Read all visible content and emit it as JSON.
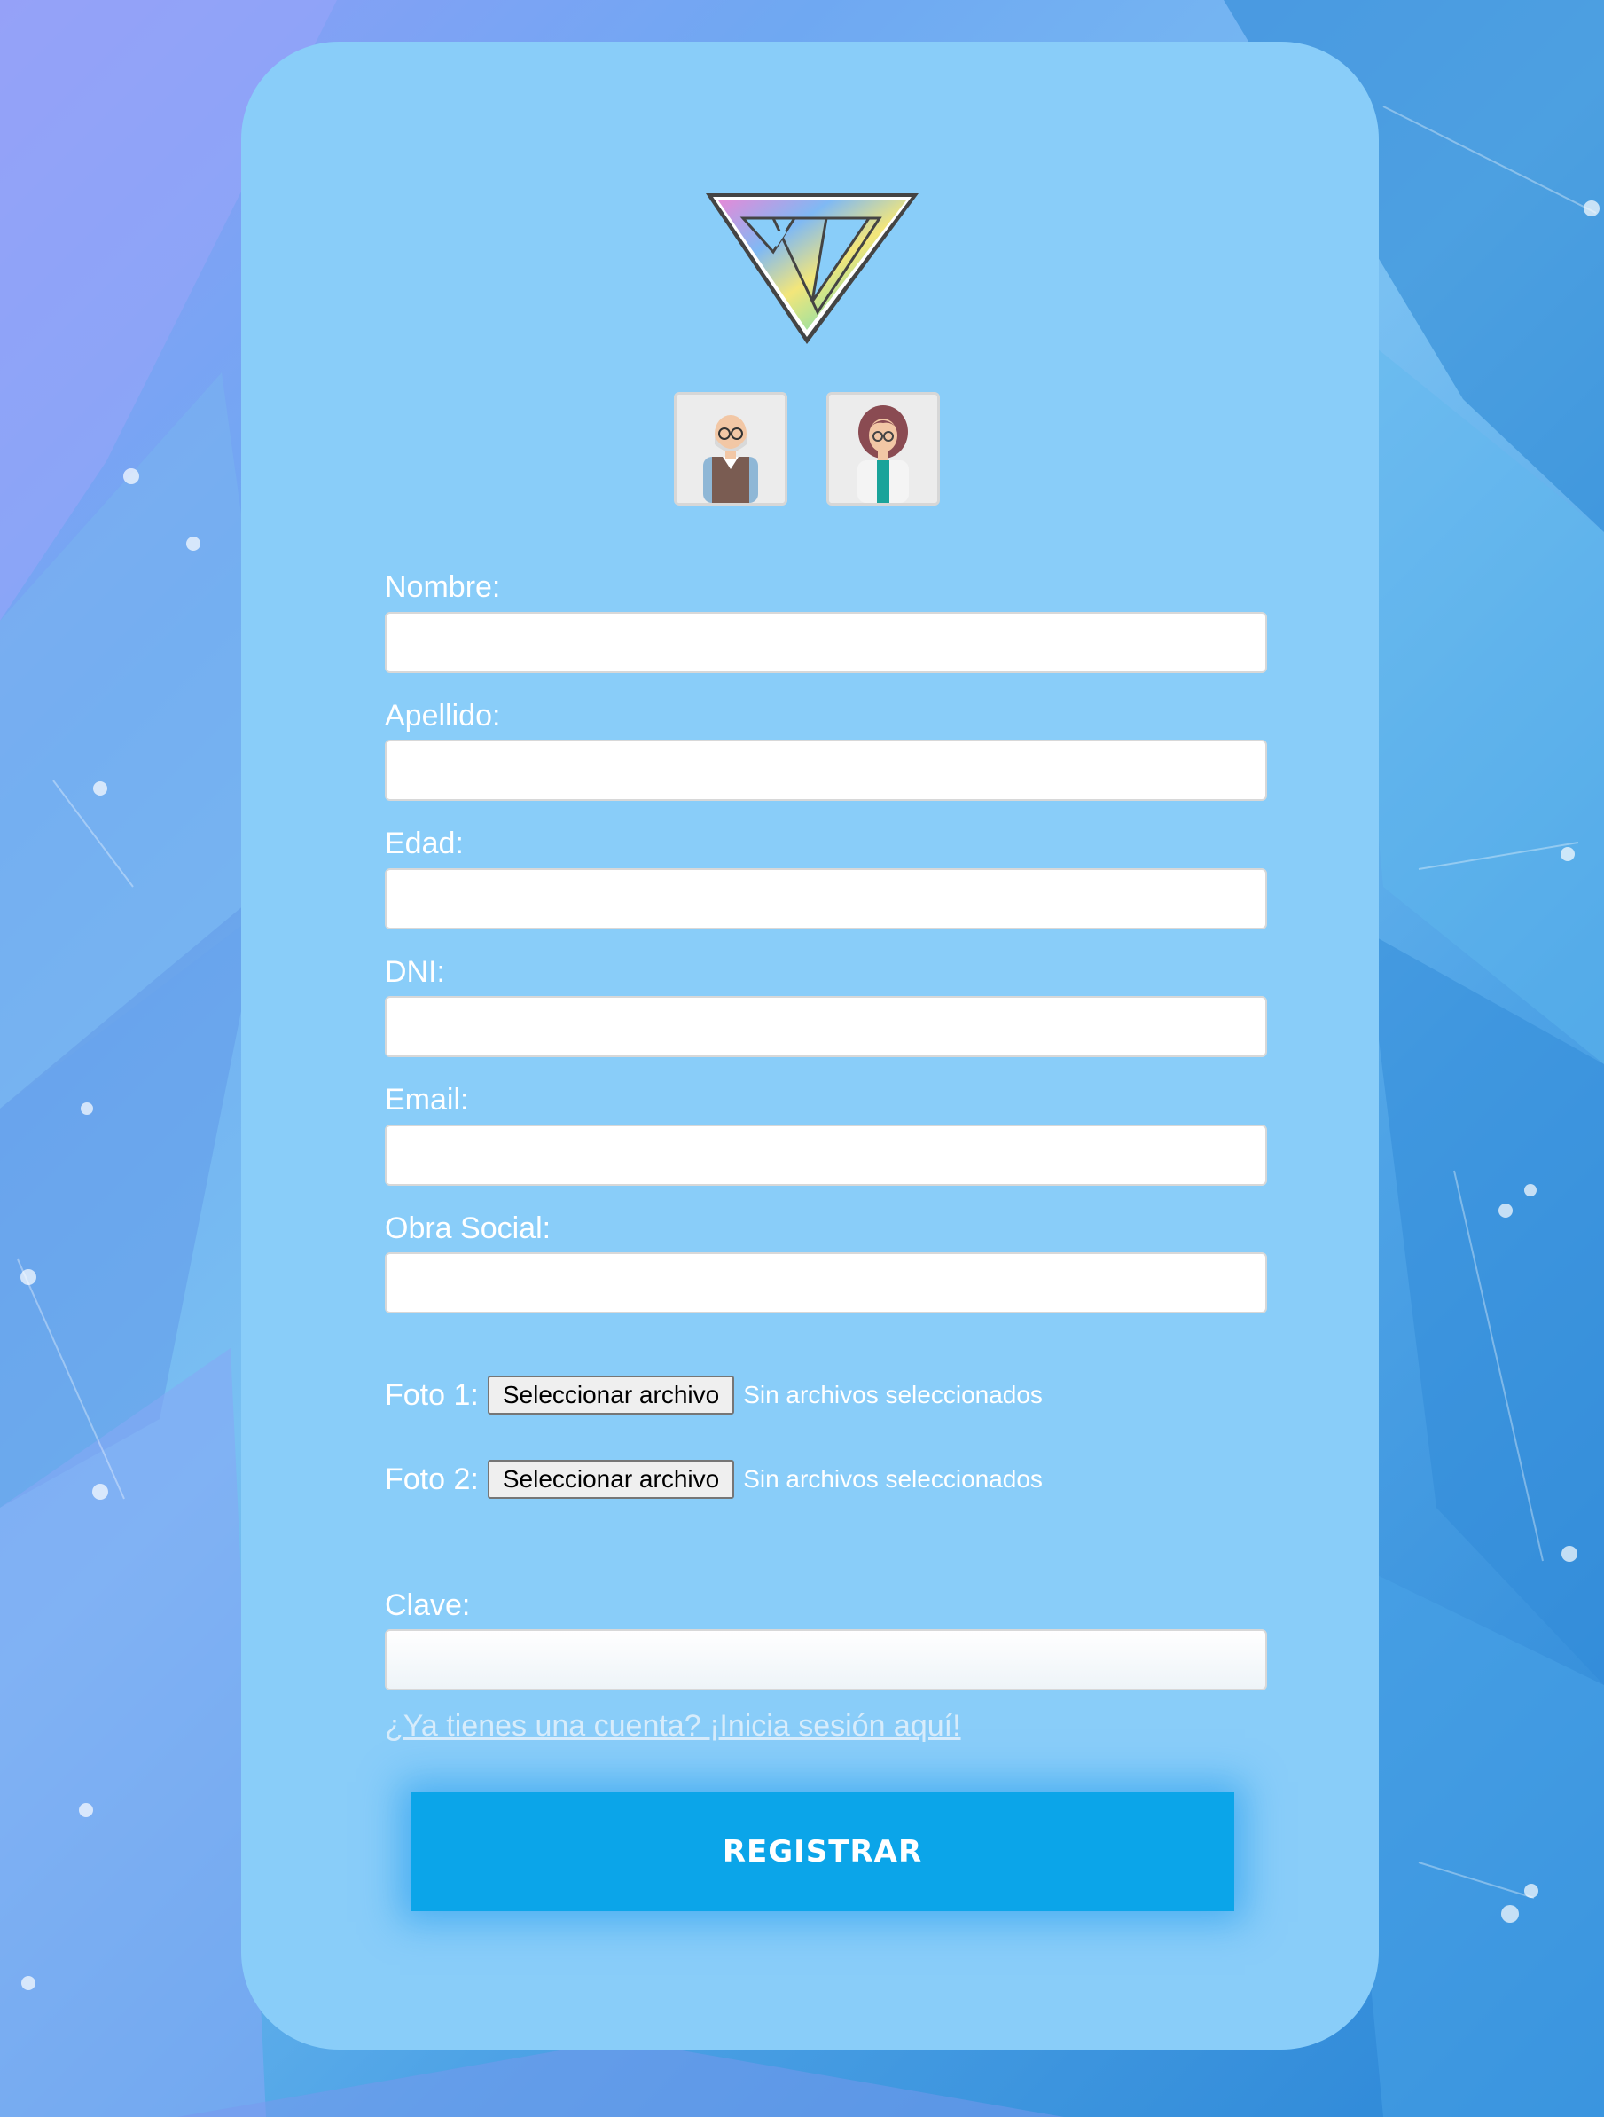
{
  "theme": {
    "card_bg": "#89cdf9",
    "button_bg": "#0ba5e9",
    "label_color": "#ffffff",
    "link_color": "#d7ecfb"
  },
  "logo": {
    "icon": "triangle-w-logo"
  },
  "avatars": [
    {
      "icon": "patient-elderly-man-avatar"
    },
    {
      "icon": "doctor-woman-avatar"
    }
  ],
  "form": {
    "nombre": {
      "label": "Nombre:",
      "value": ""
    },
    "apellido": {
      "label": "Apellido:",
      "value": ""
    },
    "edad": {
      "label": "Edad:",
      "value": ""
    },
    "dni": {
      "label": "DNI:",
      "value": ""
    },
    "email": {
      "label": "Email:",
      "value": ""
    },
    "obra_social": {
      "label": "Obra Social:",
      "value": ""
    },
    "foto1": {
      "label": "Foto 1:",
      "button": "Seleccionar archivo",
      "status": "Sin archivos seleccionados"
    },
    "foto2": {
      "label": "Foto 2:",
      "button": "Seleccionar archivo",
      "status": "Sin archivos seleccionados"
    },
    "clave": {
      "label": "Clave:",
      "value": ""
    },
    "login_link": "¿Ya tienes una cuenta? ¡Inicia sesión aquí!",
    "submit": "REGISTRAR"
  }
}
